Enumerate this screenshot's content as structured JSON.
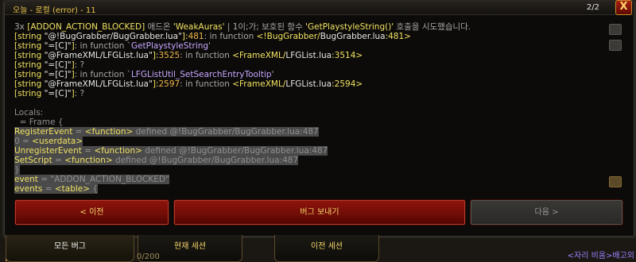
{
  "window": {
    "title": "오늘 - 로컬 (error) - 11",
    "counter": "2/2",
    "close_label": "X"
  },
  "log_lines": [
    {
      "parts": [
        {
          "c": "g",
          "t": "3x "
        },
        {
          "c": "y",
          "t": "[ADDON_ACTION_BLOCKED]"
        },
        {
          "c": "g",
          "t": " 애드온 "
        },
        {
          "c": "y",
          "t": "'WeakAuras'"
        },
        {
          "c": "g",
          "t": " | 1이;가; 보호된 함수 "
        },
        {
          "c": "y",
          "t": "'GetPlaystyleString()'"
        },
        {
          "c": "g",
          "t": " 호출을 시도했습니다."
        }
      ]
    },
    {
      "parts": [
        {
          "c": "y",
          "t": "[string "
        },
        {
          "c": "w",
          "t": "\"@!BugGrabber/"
        },
        {
          "c": "w",
          "t": "BugGrabber.lua\""
        },
        {
          "c": "y",
          "t": "]:"
        },
        {
          "c": "o",
          "t": "481"
        },
        {
          "c": "g",
          "t": ": in function "
        },
        {
          "c": "y",
          "t": "<!BugGrabber/"
        },
        {
          "c": "w",
          "t": "BugGrabber.lua"
        },
        {
          "c": "y",
          "t": ":481>"
        }
      ]
    },
    {
      "parts": [
        {
          "c": "y",
          "t": "[string "
        },
        {
          "c": "w",
          "t": "\"=[C]\""
        },
        {
          "c": "y",
          "t": "]"
        },
        {
          "c": "g",
          "t": ": in function `"
        },
        {
          "c": "p",
          "t": "GetPlaystyleString"
        },
        {
          "c": "g",
          "t": "'"
        }
      ]
    },
    {
      "parts": [
        {
          "c": "y",
          "t": "[string "
        },
        {
          "c": "w",
          "t": "\"@FrameXML/"
        },
        {
          "c": "w",
          "t": "LFGList.lua\""
        },
        {
          "c": "y",
          "t": "]:"
        },
        {
          "c": "o",
          "t": "3525"
        },
        {
          "c": "g",
          "t": ": in function "
        },
        {
          "c": "y",
          "t": "<FrameXML/"
        },
        {
          "c": "w",
          "t": "LFGList.lua"
        },
        {
          "c": "y",
          "t": ":3514>"
        }
      ]
    },
    {
      "parts": [
        {
          "c": "y",
          "t": "[string "
        },
        {
          "c": "w",
          "t": "\"=[C]\""
        },
        {
          "c": "y",
          "t": "]"
        },
        {
          "c": "g",
          "t": ": ?"
        }
      ]
    },
    {
      "parts": [
        {
          "c": "y",
          "t": "[string "
        },
        {
          "c": "w",
          "t": "\"=[C]\""
        },
        {
          "c": "y",
          "t": "]"
        },
        {
          "c": "g",
          "t": ": in function `"
        },
        {
          "c": "p",
          "t": "LFGListUtil_SetSearchEntryTooltip"
        },
        {
          "c": "g",
          "t": "'"
        }
      ]
    },
    {
      "parts": [
        {
          "c": "y",
          "t": "[string "
        },
        {
          "c": "w",
          "t": "\"@FrameXML/"
        },
        {
          "c": "w",
          "t": "LFGList.lua\""
        },
        {
          "c": "y",
          "t": "]:"
        },
        {
          "c": "o",
          "t": "2597"
        },
        {
          "c": "g",
          "t": ": in function "
        },
        {
          "c": "y",
          "t": "<FrameXML/"
        },
        {
          "c": "w",
          "t": "LFGList.lua"
        },
        {
          "c": "y",
          "t": ":2594>"
        }
      ]
    },
    {
      "parts": [
        {
          "c": "y",
          "t": "[string "
        },
        {
          "c": "w",
          "t": "\"=[C]\""
        },
        {
          "c": "y",
          "t": "]"
        },
        {
          "c": "g",
          "t": ": ?"
        }
      ]
    },
    {
      "parts": [
        {
          "c": "g",
          "t": ""
        }
      ]
    },
    {
      "parts": [
        {
          "c": "gray",
          "t": "Locals:"
        }
      ]
    },
    {
      "parts": [
        {
          "c": "gray",
          "t": "  = Frame {"
        }
      ]
    },
    {
      "hl": true,
      "parts": [
        {
          "c": "y",
          "t": "RegisterEvent"
        },
        {
          "c": "gray",
          "t": " = "
        },
        {
          "c": "y",
          "t": "<function>"
        },
        {
          "c": "gray",
          "t": " defined @!BugGrabber/BugGrabber.lua:487"
        }
      ]
    },
    {
      "hl": true,
      "parts": [
        {
          "c": "gray",
          "t": "0 = "
        },
        {
          "c": "y",
          "t": "<userdata>"
        }
      ]
    },
    {
      "hl": true,
      "parts": [
        {
          "c": "y",
          "t": "UnregisterEvent"
        },
        {
          "c": "gray",
          "t": " = "
        },
        {
          "c": "y",
          "t": "<function>"
        },
        {
          "c": "gray",
          "t": " defined @!BugGrabber/BugGrabber.lua:487"
        }
      ]
    },
    {
      "hl": true,
      "parts": [
        {
          "c": "y",
          "t": "SetScript"
        },
        {
          "c": "gray",
          "t": " = "
        },
        {
          "c": "y",
          "t": "<function>"
        },
        {
          "c": "gray",
          "t": " defined @!BugGrabber/BugGrabber.lua:487"
        }
      ]
    },
    {
      "hl": true,
      "parts": [
        {
          "c": "gray",
          "t": "}"
        }
      ]
    },
    {
      "hl": true,
      "parts": [
        {
          "c": "y",
          "t": "event"
        },
        {
          "c": "gray",
          "t": " = \"ADDON_ACTION_BLOCKED\""
        }
      ]
    },
    {
      "hl": true,
      "parts": [
        {
          "c": "y",
          "t": "events"
        },
        {
          "c": "gray",
          "t": " = "
        },
        {
          "c": "y",
          "t": "<table>"
        },
        {
          "c": "gray",
          "t": " {"
        }
      ]
    }
  ],
  "buttons": {
    "prev": "< 이전",
    "send": "버그 보내기",
    "next": "다음 >"
  },
  "tabs": {
    "all": "모든 버그",
    "session": "현재 세션",
    "previous": "이전 세션"
  },
  "footer": {
    "bottom_right": "<자리 비움>배고외",
    "bottom_left": "0/200"
  },
  "icons": {
    "side_top": "arrow-up-icon",
    "side_mid": "square-button-icon",
    "side_bottom": "gear-icon"
  }
}
